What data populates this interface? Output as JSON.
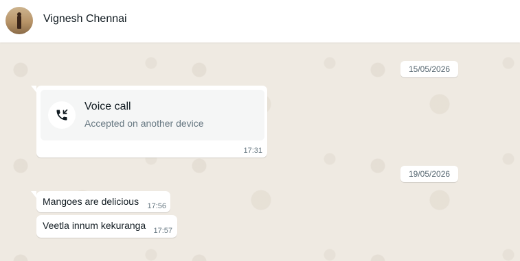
{
  "header": {
    "contact_name": "Vignesh Chennai"
  },
  "chat": {
    "dates": [
      "15/05/2026",
      "19/05/2026"
    ],
    "call": {
      "title": "Voice call",
      "subtitle": "Accepted on another device",
      "time": "17:31",
      "icon": "incoming-call-icon"
    },
    "messages": [
      {
        "text": "Mangoes are delicious",
        "time": "17:56"
      },
      {
        "text": "Veetla innum kekuranga",
        "time": "17:57"
      }
    ]
  },
  "colors": {
    "header_bg": "#ffffff",
    "chat_bg": "#efeae2",
    "bubble_bg": "#ffffff",
    "text_primary": "#111b21",
    "text_secondary": "#667781"
  }
}
